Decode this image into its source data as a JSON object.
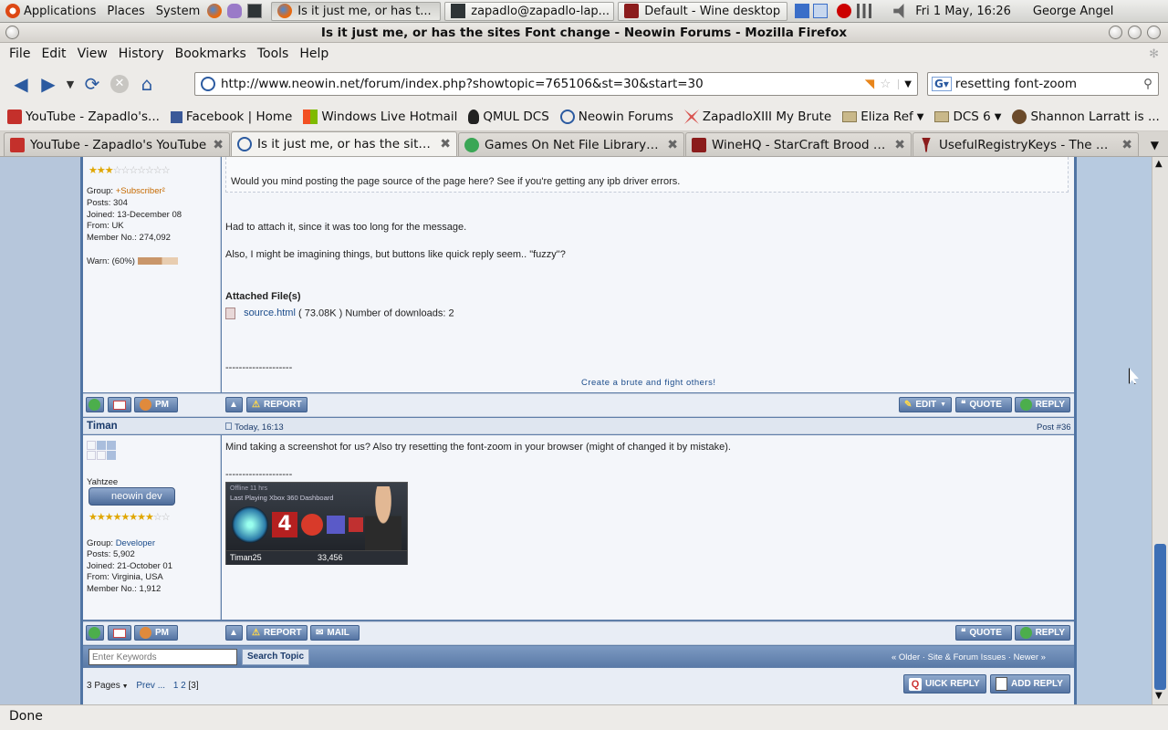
{
  "panel": {
    "menus": [
      "Applications",
      "Places",
      "System"
    ],
    "tasks": [
      {
        "label": "Is it just me, or has t...",
        "active": true
      },
      {
        "label": "zapadlo@zapadlo-lap...",
        "active": false
      },
      {
        "label": "Default - Wine desktop",
        "active": false
      }
    ],
    "clock": "Fri  1 May, 16:26",
    "user": "George Angel"
  },
  "window": {
    "title": "Is it just me, or has the sites Font change - Neowin Forums - Mozilla Firefox"
  },
  "menubar": [
    "File",
    "Edit",
    "View",
    "History",
    "Bookmarks",
    "Tools",
    "Help"
  ],
  "nav": {
    "url": "http://www.neowin.net/forum/index.php?showtopic=765106&st=30&start=30",
    "search": "resetting font-zoom"
  },
  "bookmarks": [
    "YouTube - Zapadlo's...",
    "Facebook | Home",
    "Windows Live Hotmail",
    "QMUL DCS",
    "Neowin Forums",
    "ZapadloXIII My Brute",
    "Eliza Ref",
    "DCS 6",
    "Shannon Larratt is ..."
  ],
  "tabs": [
    {
      "label": "YouTube - Zapadlo's YouTube",
      "active": false
    },
    {
      "label": "Is it just me, or has the site...",
      "active": true
    },
    {
      "label": "Games On Net File Library ::...",
      "active": false
    },
    {
      "label": "WineHQ - StarCraft Brood W...",
      "active": false
    },
    {
      "label": "UsefulRegistryKeys - The Off...",
      "active": false
    }
  ],
  "post1": {
    "group_label": "Group:",
    "group": "+Subscriber²",
    "posts": "Posts: 304",
    "joined": "Joined: 13-December 08",
    "from": "From: UK",
    "member_no": "Member No.: 274,092",
    "warn": "Warn: (60%)",
    "quote": "Would you mind posting the page source of the page here? See if you're getting any ipb driver errors.",
    "line1": "Had to attach it, since it was too long for the message.",
    "line2": "Also, I might be imagining things, but buttons like quick reply seem.. \"fuzzy\"?",
    "attached_title": "Attached File(s)",
    "attachment_name": "source.html",
    "attachment_info": "( 73.08K ) Number of downloads: 2",
    "sig_sep": "--------------------",
    "sig_link": "Create a brute and fight others!"
  },
  "buttons": {
    "pm": "PM",
    "report": "REPORT",
    "edit": "EDIT",
    "quote": "QUOTE",
    "reply": "REPLY",
    "mail": "MAIL"
  },
  "post2": {
    "author": "Timan",
    "date": "Today, 16:13",
    "post_label": "Post",
    "post_no": "#36",
    "body": "Mind taking a screenshot for us? Also try resetting the font-zoom in your browser (might of changed it by mistake).",
    "sig_sep": "--------------------",
    "title": "Yahtzee",
    "badge": "neowin dev",
    "group_label": "Group:",
    "group": "Developer",
    "posts": "Posts: 5,902",
    "joined": "Joined: 21-October 01",
    "from": "From: Virginia, USA",
    "member_no": "Member No.: 1,912",
    "xbox_status": "Offline 11 hrs",
    "xbox_last": "Last Playing Xbox 360 Dashboard",
    "gamertag": "Timan25",
    "gamerscore": "33,456"
  },
  "footer": {
    "search_placeholder": "Enter Keywords",
    "search_button": "Search Topic",
    "older": "« Older",
    "sep": "·",
    "site_issues": "Site & Forum Issues",
    "newer": "Newer »",
    "pages": "3 Pages",
    "prev": "Prev ...",
    "page1": "1",
    "page2": "2",
    "page3": "[3]",
    "quick_reply": "UICK REPLY",
    "add_reply": "ADD REPLY"
  },
  "status": "Done"
}
